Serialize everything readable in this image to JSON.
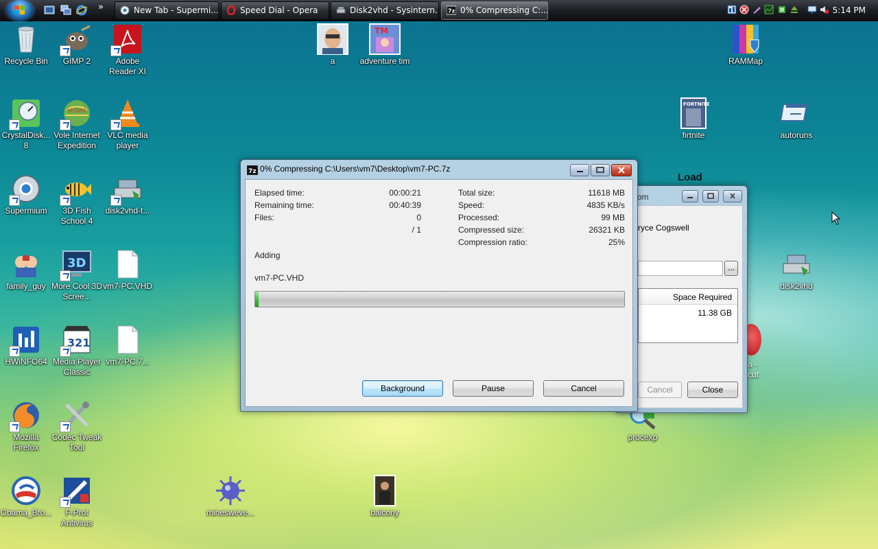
{
  "taskbar": {
    "tasks": [
      {
        "label": "New Tab - Supermi...",
        "icon": "supermium-icon"
      },
      {
        "label": "Speed Dial - Opera",
        "icon": "opera-icon"
      },
      {
        "label": "Disk2vhd - Sysintern...",
        "icon": "disk2vhd-icon"
      },
      {
        "label": "0% Compressing C:...",
        "icon": "7zip-icon"
      }
    ],
    "overflow": "»",
    "clock": "5:14 PM"
  },
  "desktop": {
    "icons": [
      {
        "label": "Recycle Bin",
        "icon": "recycle-bin-icon",
        "shortcut": false
      },
      {
        "label": "GIMP 2",
        "icon": "gimp-icon",
        "shortcut": true
      },
      {
        "label": "Adobe Reader XI",
        "icon": "adobe-reader-icon",
        "shortcut": true
      },
      {
        "label": "a",
        "icon": "photo-icon",
        "shortcut": false
      },
      {
        "label": "adventure tim",
        "icon": "photo-icon",
        "shortcut": false
      },
      {
        "label": "RAMMap",
        "icon": "rammap-icon",
        "shortcut": false
      },
      {
        "label": "CrystalDisk... 8",
        "icon": "crystaldisk-icon",
        "shortcut": true
      },
      {
        "label": "Vole Internet Expedition",
        "icon": "vole-icon",
        "shortcut": true
      },
      {
        "label": "VLC media player",
        "icon": "vlc-icon",
        "shortcut": true
      },
      {
        "label": "firtnite",
        "icon": "photo-icon",
        "shortcut": false
      },
      {
        "label": "autoruns",
        "icon": "autoruns-icon",
        "shortcut": false
      },
      {
        "label": "Supermium",
        "icon": "supermium-icon",
        "shortcut": true
      },
      {
        "label": "3D Fish School 4",
        "icon": "fish-icon",
        "shortcut": true
      },
      {
        "label": "disk2vhd-t...",
        "icon": "disk2vhd-icon",
        "shortcut": true
      },
      {
        "label": "family_guy",
        "icon": "family-guy-icon",
        "shortcut": false
      },
      {
        "label": "More Cool 3D Scree...",
        "icon": "3d-screensaver-icon",
        "shortcut": true
      },
      {
        "label": "vm7-PC.VHD",
        "icon": "file-icon",
        "shortcut": false
      },
      {
        "label": "disk2vhd",
        "icon": "disk2vhd-icon",
        "shortcut": false
      },
      {
        "label": "HWiNFO64",
        "icon": "hwinfo-icon",
        "shortcut": true
      },
      {
        "label": "Media Player Classic",
        "icon": "mpc-icon",
        "shortcut": true
      },
      {
        "label": "vm7-PC.7...",
        "icon": "file-icon",
        "shortcut": false
      },
      {
        "label": "Mozilla Firefox",
        "icon": "firefox-icon",
        "shortcut": true
      },
      {
        "label": "Codec Tweak Tool",
        "icon": "codec-tweak-icon",
        "shortcut": true
      },
      {
        "label": "procexp",
        "icon": "procexp-icon",
        "shortcut": false
      },
      {
        "label": "Obama_Bro...",
        "icon": "obama-icon",
        "shortcut": false
      },
      {
        "label": "F-Prot Antivirus",
        "icon": "fprot-icon",
        "shortcut": true
      },
      {
        "label": "minesweve...",
        "icon": "mine-icon",
        "shortcut": false
      },
      {
        "label": "balcony",
        "icon": "photo-icon",
        "shortcut": false
      }
    ],
    "partial_label_1": "a -",
    "partial_label_2": "cut",
    "partial_text_load": "Load"
  },
  "disk2vhd_window": {
    "title_partial": "om",
    "owner_partial": "ryce Cogswell",
    "browse_label": "...",
    "column_header": "Space Required",
    "value": "11.38 GB",
    "cancel_label": "Cancel",
    "close_label": "Close"
  },
  "compress_window": {
    "title": "0% Compressing C:\\Users\\vm7\\Desktop\\vm7-PC.7z",
    "app_icon_label": "7z",
    "left_stats": [
      {
        "label": "Elapsed time:",
        "value": "00:00:21"
      },
      {
        "label": "Remaining time:",
        "value": "00:40:39"
      },
      {
        "label": "Files:",
        "value": "0"
      },
      {
        "label": "",
        "value": "/ 1"
      }
    ],
    "right_stats": [
      {
        "label": "Total size:",
        "value": "11618 MB"
      },
      {
        "label": "Speed:",
        "value": "4835 KB/s"
      },
      {
        "label": "Processed:",
        "value": "99 MB"
      },
      {
        "label": "Compressed size:",
        "value": "26321 KB"
      },
      {
        "label": "Compression ratio:",
        "value": "25%"
      }
    ],
    "status": "Adding",
    "current_file": "vm7-PC.VHD",
    "progress": 0.01,
    "buttons": {
      "background": "Background",
      "pause": "Pause",
      "cancel": "Cancel"
    }
  },
  "colors": {
    "progress_fill": "#3cc23c",
    "accent": "#3c7fb1"
  }
}
